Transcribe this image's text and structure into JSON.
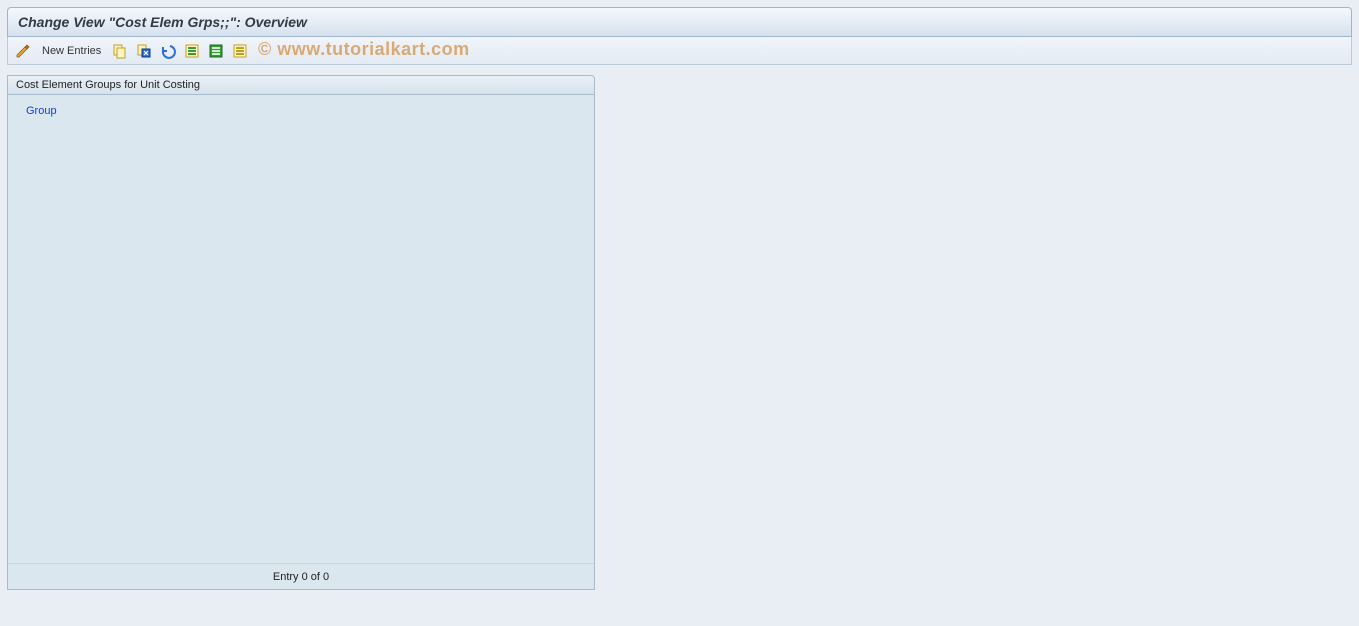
{
  "header": {
    "title": "Change View \"Cost Elem Grps;;\": Overview"
  },
  "toolbar": {
    "new_entries_label": "New Entries"
  },
  "panel": {
    "title": "Cost Element Groups for Unit Costing",
    "column_header": "Group",
    "footer": "Entry 0 of 0"
  },
  "watermark": "© www.tutorialkart.com"
}
